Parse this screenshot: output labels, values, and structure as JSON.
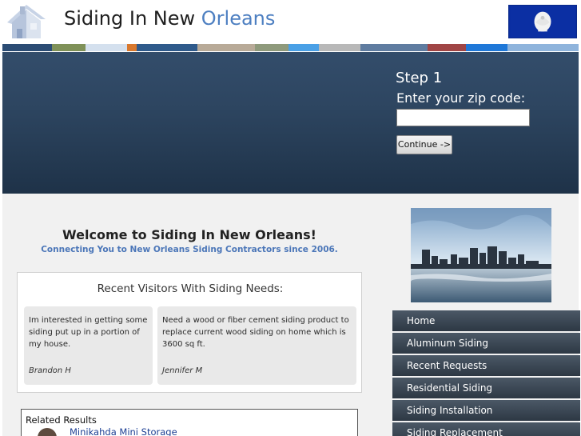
{
  "header": {
    "title_main": "Siding In New ",
    "title_accent": "Orleans"
  },
  "colors": {
    "stripe": [
      "#2b4c74",
      "#7f9158",
      "#d4e0ee",
      "#d9782d",
      "#2f5a8b",
      "#b8aa98",
      "#8f9a7c",
      "#4aa0e6",
      "#b8b8b8",
      "#5f7ca0",
      "#a04545",
      "#1f78d8",
      "#8fb4dc"
    ],
    "hero": "#2d4560",
    "nav": "#3a4653",
    "accent": "#4b76b8"
  },
  "hero": {
    "step": "Step 1",
    "zip_label": "Enter your zip code:",
    "zip_value": "",
    "continue_label": "Continue ->"
  },
  "welcome": {
    "heading": "Welcome to Siding In New Orleans!",
    "tagline": "Connecting You to New Orleans Siding Contractors since 2006."
  },
  "visitors": {
    "title": "Recent Visitors With Siding Needs:",
    "items": [
      {
        "message": "Im interested in getting some siding put up in a portion of my house.",
        "name": "Brandon H"
      },
      {
        "message": "Need a wood or fiber cement siding product to replace current wood siding on home which is 3600 sq ft.",
        "name": "Jennifer M"
      }
    ]
  },
  "related": {
    "title": "Related Results",
    "items": [
      {
        "label": "Minikahda Mini Storage"
      }
    ]
  },
  "sidebar": {
    "nav": [
      {
        "label": "Home"
      },
      {
        "label": "Aluminum Siding"
      },
      {
        "label": "Recent Requests"
      },
      {
        "label": "Residential Siding"
      },
      {
        "label": "Siding Installation"
      },
      {
        "label": "Siding Replacement"
      }
    ]
  }
}
